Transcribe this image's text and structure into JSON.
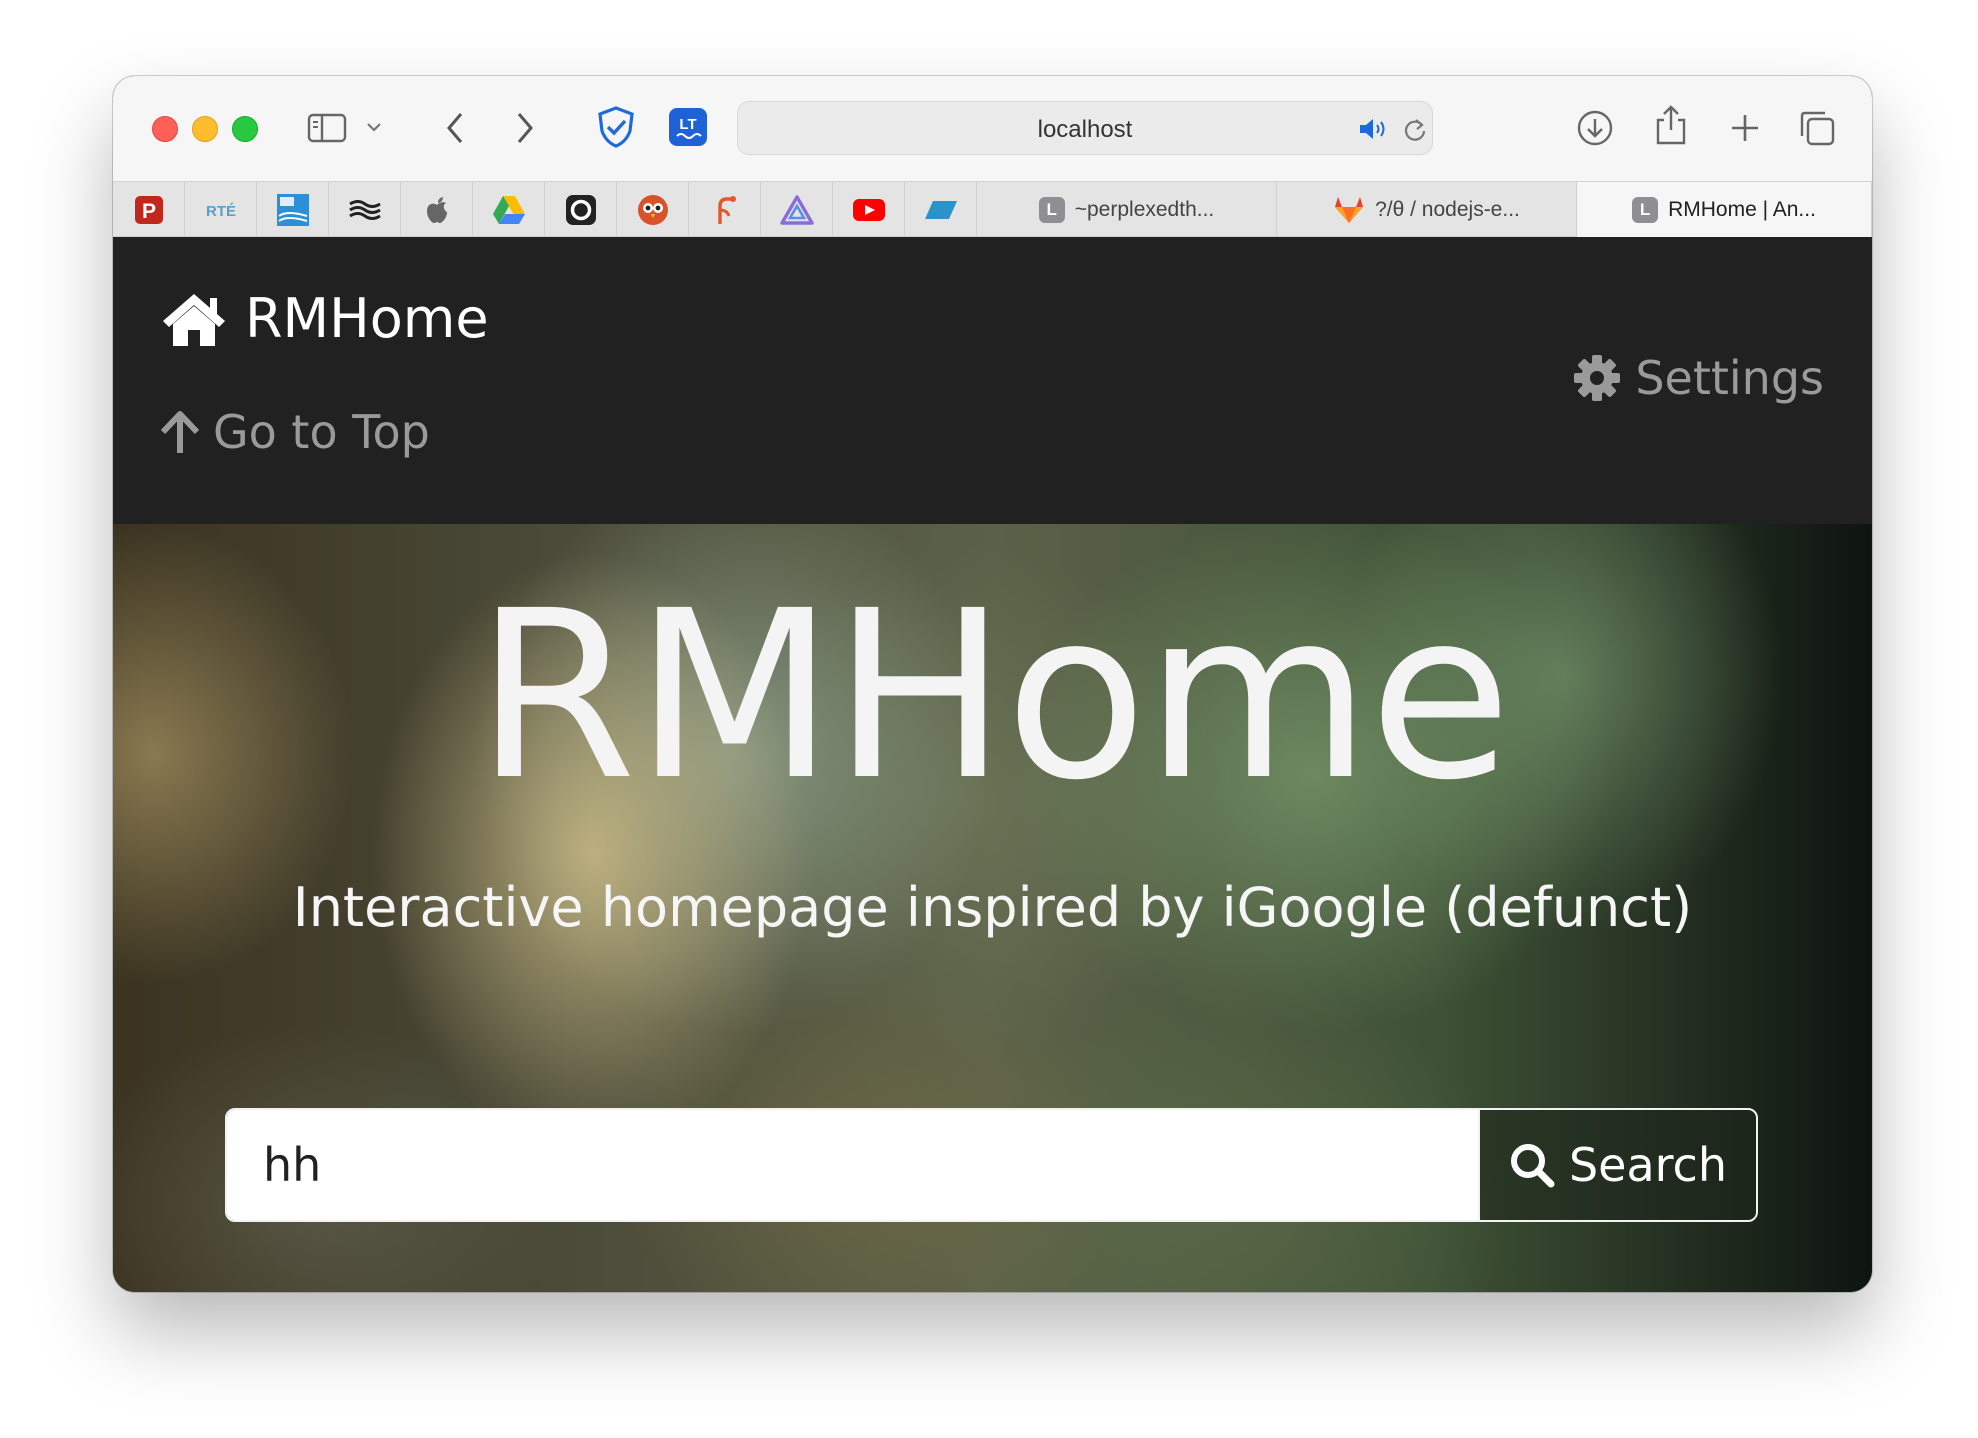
{
  "browser": {
    "address": "localhost",
    "tabs": [
      {
        "label": "~perplexedth..."
      },
      {
        "label": "?/θ / nodejs-e..."
      },
      {
        "label": "RMHome | An..."
      }
    ],
    "pinned_tabs": [
      {
        "name": "pinned-tab-p",
        "glyph": "P",
        "color": "#c1271b"
      },
      {
        "name": "pinned-tab-rte",
        "glyph": "RTÉ",
        "color": "#5aa1c8"
      },
      {
        "name": "pinned-tab-france24",
        "glyph": "FRANCE 24",
        "color": "#2d8fd6"
      },
      {
        "name": "pinned-tab-waves",
        "glyph": "",
        "color": "#222222"
      },
      {
        "name": "pinned-tab-apple",
        "glyph": "",
        "color": "#555555"
      },
      {
        "name": "pinned-tab-drive",
        "glyph": "",
        "color": "#34a853"
      },
      {
        "name": "pinned-tab-ring",
        "glyph": "",
        "color": "#222222"
      },
      {
        "name": "pinned-tab-owl",
        "glyph": "",
        "color": "#d9532a"
      },
      {
        "name": "pinned-tab-fork",
        "glyph": "",
        "color": "#e2582b"
      },
      {
        "name": "pinned-tab-triangle",
        "glyph": "",
        "color": "#8a6cd8"
      },
      {
        "name": "pinned-tab-youtube",
        "glyph": "",
        "color": "#ff0000"
      },
      {
        "name": "pinned-tab-parallelogram",
        "glyph": "",
        "color": "#2a93c9"
      }
    ],
    "tab_favicon_letter": "L"
  },
  "navbar": {
    "brand": "RMHome",
    "go_to_top": "Go to Top",
    "settings": "Settings"
  },
  "hero": {
    "title": "RMHome",
    "subtitle": "Interactive homepage inspired by iGoogle (defunct)"
  },
  "search": {
    "value": "hh",
    "button_label": "Search"
  },
  "colors": {
    "navbar_bg": "#212121",
    "muted_text": "#9a9a9a",
    "hero_text": "#f4f4f4"
  }
}
